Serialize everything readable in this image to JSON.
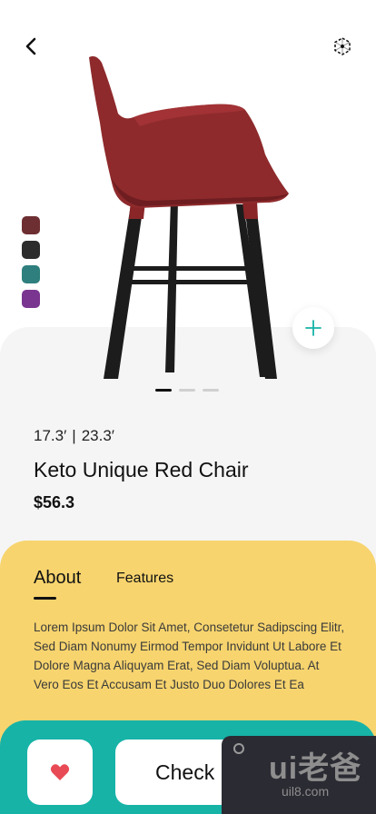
{
  "product": {
    "dimension_width": "17.3′",
    "dimension_separator": "|",
    "dimension_height": "23.3′",
    "name": "Keto Unique Red Chair",
    "price": "$56.3"
  },
  "colors": {
    "swatches": [
      "#6e2f32",
      "#2c2c2c",
      "#2e7f7d",
      "#7a3590"
    ],
    "panel_background": "#f5f5f5",
    "about_background": "#f7d46e",
    "action_bar_background": "#17b3a7",
    "heart": "#e84b55",
    "chair_seat": "#8e2a2c",
    "chair_legs": "#1c1c1c"
  },
  "carousel": {
    "total_pages": 3,
    "active_page": 1
  },
  "tabs": {
    "about_label": "About",
    "features_label": "Features",
    "active": "About"
  },
  "about": {
    "text": "Lorem Ipsum Dolor Sit Amet, Consetetur Sadipscing Elitr, Sed Diam Nonumy Eirmod Tempor Invidunt Ut Labore Et Dolore Magna Aliquyam Erat, Sed Diam Voluptua. At Vero Eos Et Accusam Et Justo Duo Dolores Et Ea"
  },
  "actions": {
    "checkout_label": "Check"
  },
  "icons": {
    "back": "chevron-left-icon",
    "ar_view": "cube-3d-icon",
    "add": "plus-icon",
    "favorite": "heart-icon"
  },
  "watermark": {
    "main": "ui老爸",
    "sub": "uil8.com"
  }
}
